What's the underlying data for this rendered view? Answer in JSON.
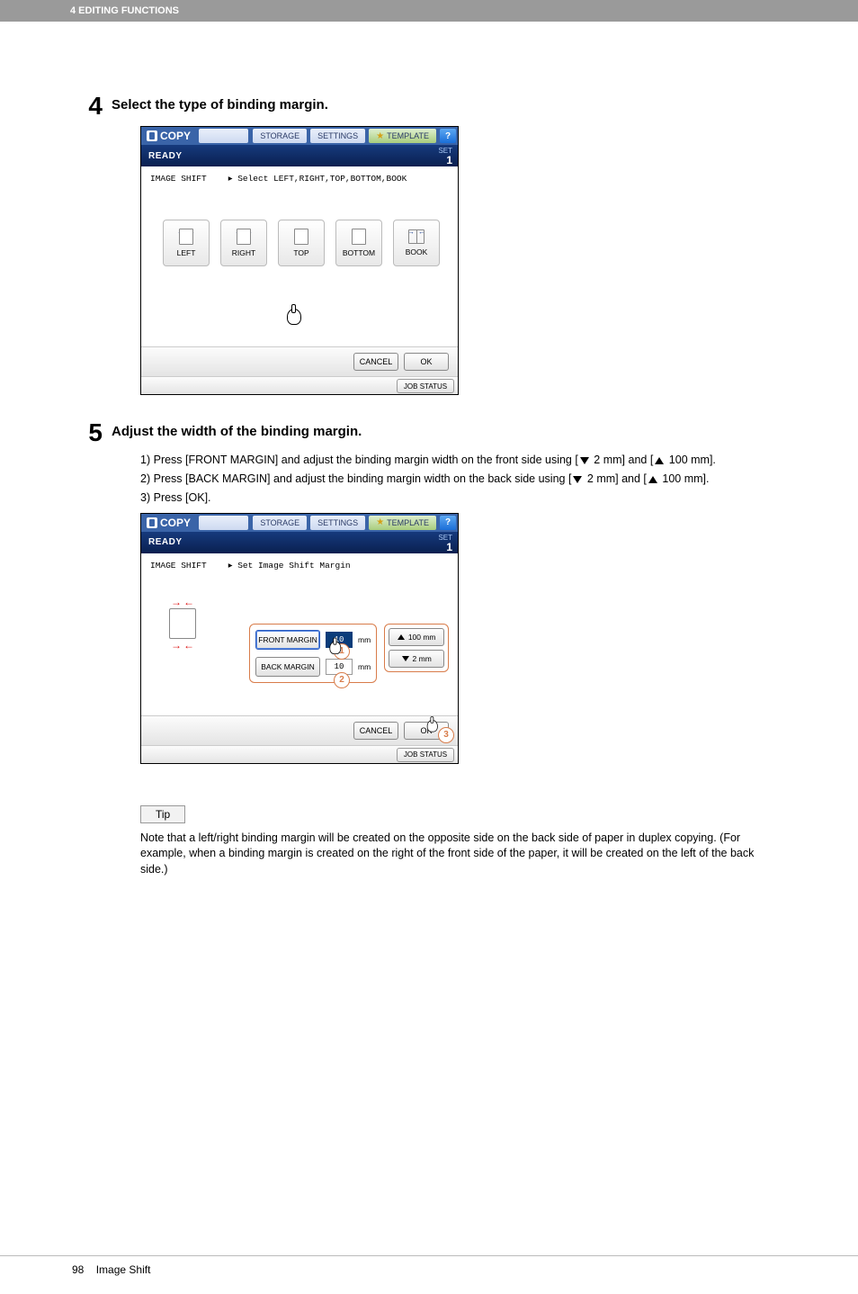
{
  "header": {
    "breadcrumb": "4 EDITING FUNCTIONS"
  },
  "step4": {
    "number": "4",
    "title": "Select the type of binding margin."
  },
  "step5": {
    "number": "5",
    "title": "Adjust the width of the binding margin.",
    "list": {
      "i1_num": "1)",
      "i1_a": "Press [FRONT MARGIN] and adjust the binding margin width on the front side using [",
      "i1_b": " 2 mm] and [",
      "i1_c": " 100 mm].",
      "i2_num": "2)",
      "i2_a": "Press [BACK MARGIN] and adjust the binding margin width on the back side using [",
      "i2_b": " 2 mm] and [",
      "i2_c": " 100 mm].",
      "i3_num": "3)",
      "i3_a": "Press [OK]."
    }
  },
  "ui": {
    "topbar": {
      "copy": "COPY",
      "storage": "STORAGE",
      "settings": "SETTINGS",
      "template": "TEMPLATE",
      "help": "?"
    },
    "ready": "READY",
    "set": "SET",
    "set_count": "1",
    "screen1": {
      "label": "IMAGE SHIFT",
      "instruction": "▸ Select LEFT,RIGHT,TOP,BOTTOM,BOOK",
      "options": {
        "left": "LEFT",
        "right": "RIGHT",
        "top": "TOP",
        "bottom": "BOTTOM",
        "book": "BOOK"
      }
    },
    "screen2": {
      "label": "IMAGE SHIFT",
      "instruction": "▸ Set Image Shift Margin",
      "front_margin": "FRONT MARGIN",
      "back_margin": "BACK MARGIN",
      "front_val": "10",
      "back_val": "10",
      "unit": "mm",
      "inc": "100 mm",
      "dec": "2 mm"
    },
    "cancel": "CANCEL",
    "ok": "OK",
    "job_status": "JOB STATUS"
  },
  "annotations": {
    "n1": "1",
    "n2": "2",
    "n3": "3"
  },
  "tip": {
    "label": "Tip",
    "text": "Note that a left/right binding margin will be created on the opposite side on the back side of paper in duplex copying. (For example, when a binding margin is created on the right of the front side of the paper, it will be created on the left of the back side.)"
  },
  "footer": {
    "page": "98",
    "title": "Image Shift"
  }
}
